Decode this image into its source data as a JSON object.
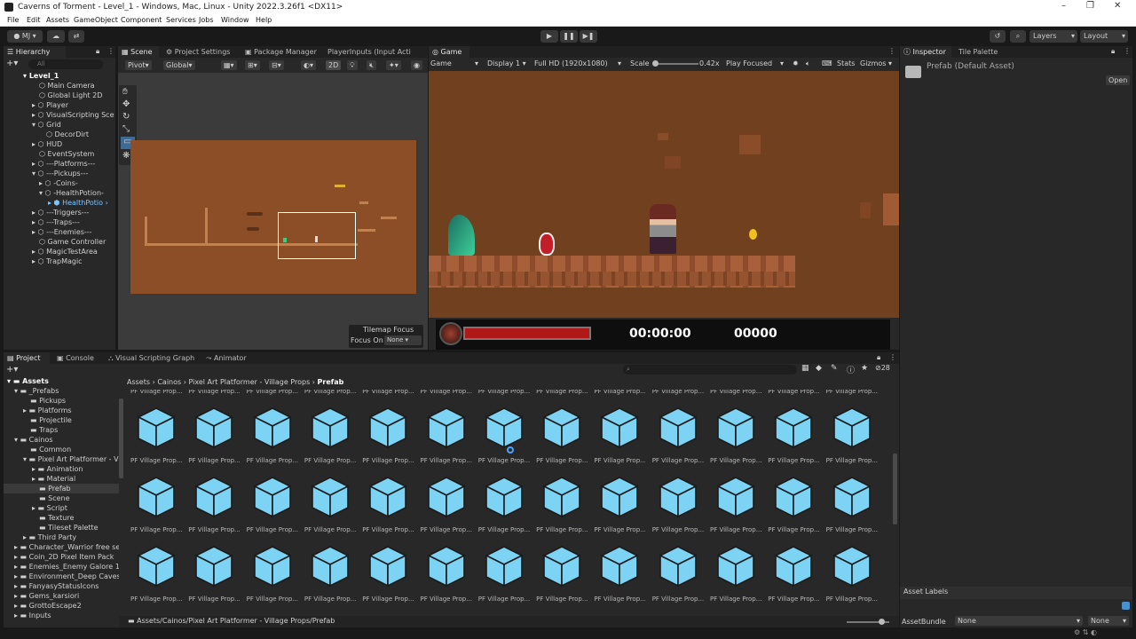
{
  "window": {
    "title": "Caverns of Torment - Level_1 - Windows, Mac, Linux - Unity 2022.3.26f1 <DX11>",
    "minimize_glyph": "–",
    "maximize_glyph": "❐",
    "close_glyph": "✕"
  },
  "menu": [
    "File",
    "Edit",
    "Assets",
    "GameObject",
    "Component",
    "Services",
    "Jobs",
    "Window",
    "Help"
  ],
  "toolbar": {
    "account": "MJ",
    "layers": "Layers",
    "layout": "Layout"
  },
  "hierarchy": {
    "tab": "Hierarchy",
    "search_placeholder": "All",
    "items": [
      {
        "label": "Level_1"
      },
      {
        "label": "Main Camera"
      },
      {
        "label": "Global Light 2D"
      },
      {
        "label": "Player"
      },
      {
        "label": "VisualScripting Sce"
      },
      {
        "label": "Grid"
      },
      {
        "label": "DecorDirt"
      },
      {
        "label": "HUD"
      },
      {
        "label": "EventSystem"
      },
      {
        "label": "---Platforms---"
      },
      {
        "label": "---Pickups---"
      },
      {
        "label": "-Coins-"
      },
      {
        "label": "-HealthPotion-"
      },
      {
        "label": "HealthPotio"
      },
      {
        "label": "---Triggers---"
      },
      {
        "label": "---Traps---"
      },
      {
        "label": "---Enemies---"
      },
      {
        "label": "Game Controller"
      },
      {
        "label": "MagicTestArea"
      },
      {
        "label": "TrapMagic"
      }
    ]
  },
  "scene": {
    "tabs": [
      "Scene",
      "Project Settings",
      "Package Manager",
      "PlayerInputs (Input Acti"
    ],
    "pivot": "Pivot",
    "global": "Global",
    "mode2d": "2D",
    "tilemap_focus": {
      "title": "Tilemap Focus",
      "label": "Focus On",
      "value": "None"
    }
  },
  "game": {
    "tab": "Game",
    "display_mode": "Game",
    "display": "Display 1",
    "resolution": "Full HD (1920x1080)",
    "scale_label": "Scale",
    "scale_value": "0.42x",
    "play_mode": "Play Focused",
    "stats": "Stats",
    "gizmos": "Gizmos",
    "hud": {
      "timer": "00:00:00",
      "score": "00000",
      "health": 1.0
    }
  },
  "inspector": {
    "tabs": [
      "Inspector",
      "Tile Palette"
    ],
    "title": "Prefab (Default Asset)",
    "open": "Open",
    "asset_labels": "Asset Labels",
    "assetbundle_label": "AssetBundle",
    "assetbundle_value": "None",
    "variant_value": "None"
  },
  "bottom_tabs": [
    "Project",
    "Console",
    "Visual Scripting Graph",
    "Animator"
  ],
  "project": {
    "count": "28",
    "breadcrumb": [
      "Assets",
      "Cainos",
      "Pixel Art Platformer - Village Props",
      "Prefab"
    ],
    "footer_path": "Assets/Cainos/Pixel Art Platformer - Village Props/Prefab",
    "item_label": "PF Village Prop...",
    "tree": [
      {
        "label": "Assets"
      },
      {
        "label": "_Prefabs"
      },
      {
        "label": "Pickups"
      },
      {
        "label": "Platforms"
      },
      {
        "label": "Projectile"
      },
      {
        "label": "Traps"
      },
      {
        "label": "Cainos"
      },
      {
        "label": "Common"
      },
      {
        "label": "Pixel Art Platformer - Vi"
      },
      {
        "label": "Animation"
      },
      {
        "label": "Material"
      },
      {
        "label": "Prefab"
      },
      {
        "label": "Scene"
      },
      {
        "label": "Script"
      },
      {
        "label": "Texture"
      },
      {
        "label": "Tileset Palette"
      },
      {
        "label": "Third Party"
      },
      {
        "label": "Character_Warrior free set"
      },
      {
        "label": "Coin_2D Pixel Item Pack"
      },
      {
        "label": "Enemies_Enemy Galore 1 -"
      },
      {
        "label": "Environment_Deep Caves"
      },
      {
        "label": "FanyasyStatusIcons"
      },
      {
        "label": "Gems_karsiori"
      },
      {
        "label": "GrottoEscape2"
      },
      {
        "label": "Inputs"
      }
    ]
  },
  "colors": {
    "accent": "#2c5d87",
    "cube": "#7dd3f3",
    "game_bg": "#71401f",
    "scene_bg": "#8c4e27",
    "health": "#b01818"
  }
}
